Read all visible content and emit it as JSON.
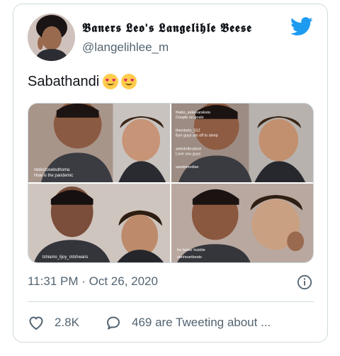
{
  "tweet": {
    "display_name": "𝕭𝖆𝖓𝖊𝖗𝖘 𝕷𝖊𝖔'𝖘 𝕷𝖆𝖓𝖌𝖊𝖑𝖎𝖍𝖑𝖊 𝕭𝖊𝖊𝖘𝖊",
    "handle": "@langelihlee_m",
    "text": "Sabathandi",
    "emojis": [
      "heart-eyes-emoji",
      "heart-eyes-emoji"
    ],
    "timestamp": "11:31 PM · Oct 26, 2020",
    "likes": "2.8K",
    "replies_label": "469 are Tweeting about ..."
  },
  "media": {
    "photos": [
      {
        "overlay_comments": [
          "ntokozosebuthoma",
          "How is the pandemic"
        ]
      },
      {
        "overlay_comments": [
          "thabo_sekakarakala",
          "Couple on goals",
          "thembelo_012",
          "Bye guys am off to sleep",
          "aelednfteodore",
          "Love you guys",
          "sandomodise"
        ]
      },
      {
        "overlay_comments": [
          "tshiamo_lijoy_mtshwaris"
        ]
      },
      {
        "overlay_comments": [
          "for better hubble",
          "uonheartbeats"
        ]
      }
    ]
  },
  "colors": {
    "brand": "#1d9bf0",
    "text_primary": "#0f1419",
    "text_secondary": "#536471",
    "border": "#cfd9de"
  },
  "icons": {
    "brand": "twitter-bird-icon",
    "info": "info-icon",
    "like": "heart-outline-icon",
    "reply": "speech-bubble-icon"
  }
}
